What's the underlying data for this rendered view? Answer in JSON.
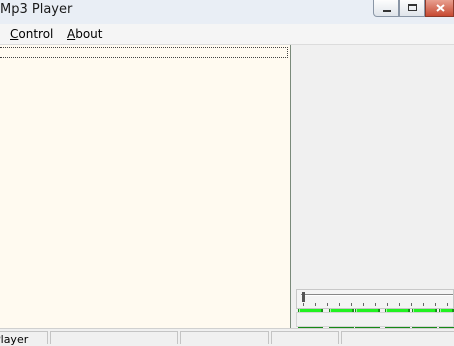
{
  "window": {
    "title": "Mp3 Player",
    "controls": [
      "minimize-icon",
      "maximize-icon",
      "close-icon"
    ]
  },
  "menu": {
    "items": [
      {
        "label": "Control",
        "mnemonic": "C",
        "rest": "ontrol"
      },
      {
        "label": "About",
        "mnemonic": "A",
        "rest": "bout"
      }
    ]
  },
  "playlist": {
    "items": []
  },
  "player": {
    "buttons": [
      {
        "name": "play",
        "glyph": "→"
      },
      {
        "name": "pause",
        "glyph": "||"
      },
      {
        "name": "stop",
        "glyph": ""
      },
      {
        "name": "previous",
        "glyph": "|<"
      },
      {
        "name": "next",
        "glyph": ">|"
      },
      {
        "name": "forward",
        "glyph": ">"
      }
    ],
    "seek_fraction": 0
  },
  "status": {
    "panes": [
      {
        "text": "Player"
      },
      {
        "text": ""
      },
      {
        "text": ""
      },
      {
        "text": ""
      },
      {
        "text": ""
      }
    ]
  },
  "colors": {
    "playlist_bg": "#fffaf0",
    "button_green": "#21f221"
  }
}
